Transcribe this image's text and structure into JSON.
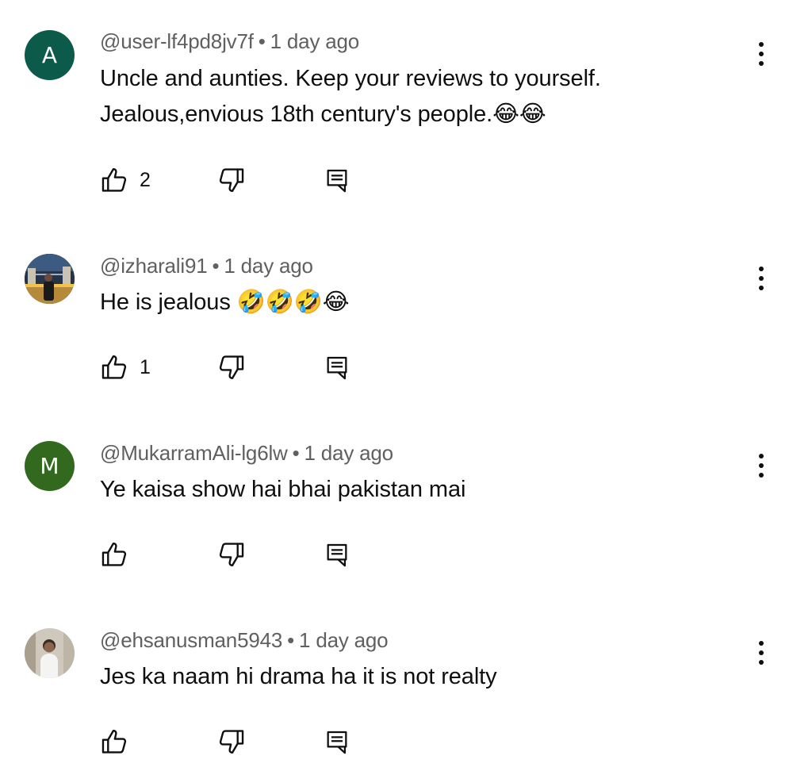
{
  "comments": [
    {
      "avatar": {
        "type": "letter",
        "letter": "A",
        "color": "#0b5a4a"
      },
      "handle": "@user-lf4pd8jv7f",
      "time": "1 day ago",
      "lines": [
        "Uncle  and aunties. Keep your reviews to yourself.",
        "Jealous,envious 18th century's people.😂😂"
      ],
      "likes": "2"
    },
    {
      "avatar": {
        "type": "photo",
        "description_icon": "photo-avatar"
      },
      "handle": "@izharali91",
      "time": "1 day ago",
      "lines": [
        "He is jealous 🤣🤣🤣😂"
      ],
      "likes": "1"
    },
    {
      "avatar": {
        "type": "letter",
        "letter": "M",
        "color": "#33691e"
      },
      "handle": "@MukarramAli-lg6lw",
      "time": "1 day ago",
      "lines": [
        "Ye kaisa show hai bhai pakistan mai"
      ],
      "likes": ""
    },
    {
      "avatar": {
        "type": "photo",
        "description_icon": "photo-avatar"
      },
      "handle": "@ehsanusman5943",
      "time": "1 day ago",
      "lines": [
        "Jes ka naam hi drama ha it is not realty"
      ],
      "likes": ""
    }
  ],
  "separator": "•",
  "icons": {
    "like": "thumb-up-icon",
    "dislike": "thumb-down-icon",
    "reply": "reply-icon",
    "menu": "more-vert-icon"
  }
}
